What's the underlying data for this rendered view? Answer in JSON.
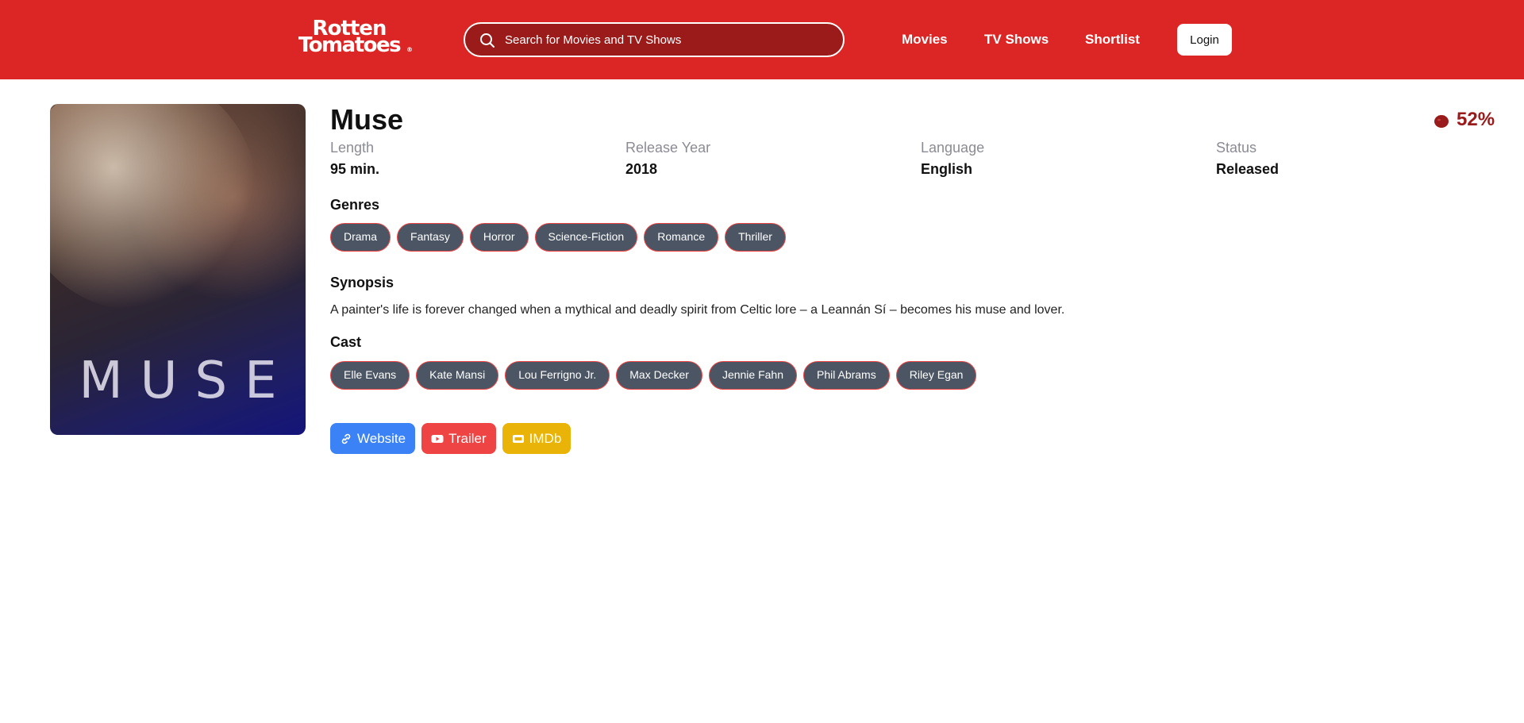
{
  "header": {
    "logo_line1": "Rotten",
    "logo_line2": "Tomatoes",
    "logo_reg": "®",
    "search_placeholder": "Search for Movies and TV Shows",
    "nav": [
      "Movies",
      "TV Shows",
      "Shortlist"
    ],
    "login_label": "Login",
    "brand_color": "#dc2626"
  },
  "poster": {
    "title_text": "MUSE"
  },
  "movie": {
    "title": "Muse",
    "score": "52%",
    "score_icon": "tomato-icon",
    "meta": [
      {
        "label": "Length",
        "value": "95 min."
      },
      {
        "label": "Release Year",
        "value": "2018"
      },
      {
        "label": "Language",
        "value": "English"
      },
      {
        "label": "Status",
        "value": "Released"
      }
    ],
    "genres_heading": "Genres",
    "genres": [
      "Drama",
      "Fantasy",
      "Horror",
      "Science-Fiction",
      "Romance",
      "Thriller"
    ],
    "synopsis_heading": "Synopsis",
    "synopsis": "A painter's life is forever changed when a mythical and deadly spirit from Celtic lore – a Leannán Sí – becomes his muse and lover.",
    "cast_heading": "Cast",
    "cast": [
      "Elle Evans",
      "Kate Mansi",
      "Lou Ferrigno Jr.",
      "Max Decker",
      "Jennie Fahn",
      "Phil Abrams",
      "Riley Egan"
    ],
    "links": [
      {
        "label": "Website",
        "icon": "link-icon",
        "color": "#3b82f6"
      },
      {
        "label": "Trailer",
        "icon": "youtube-icon",
        "color": "#ef4444"
      },
      {
        "label": "IMDb",
        "icon": "imdb-icon",
        "color": "#eab308"
      }
    ]
  }
}
